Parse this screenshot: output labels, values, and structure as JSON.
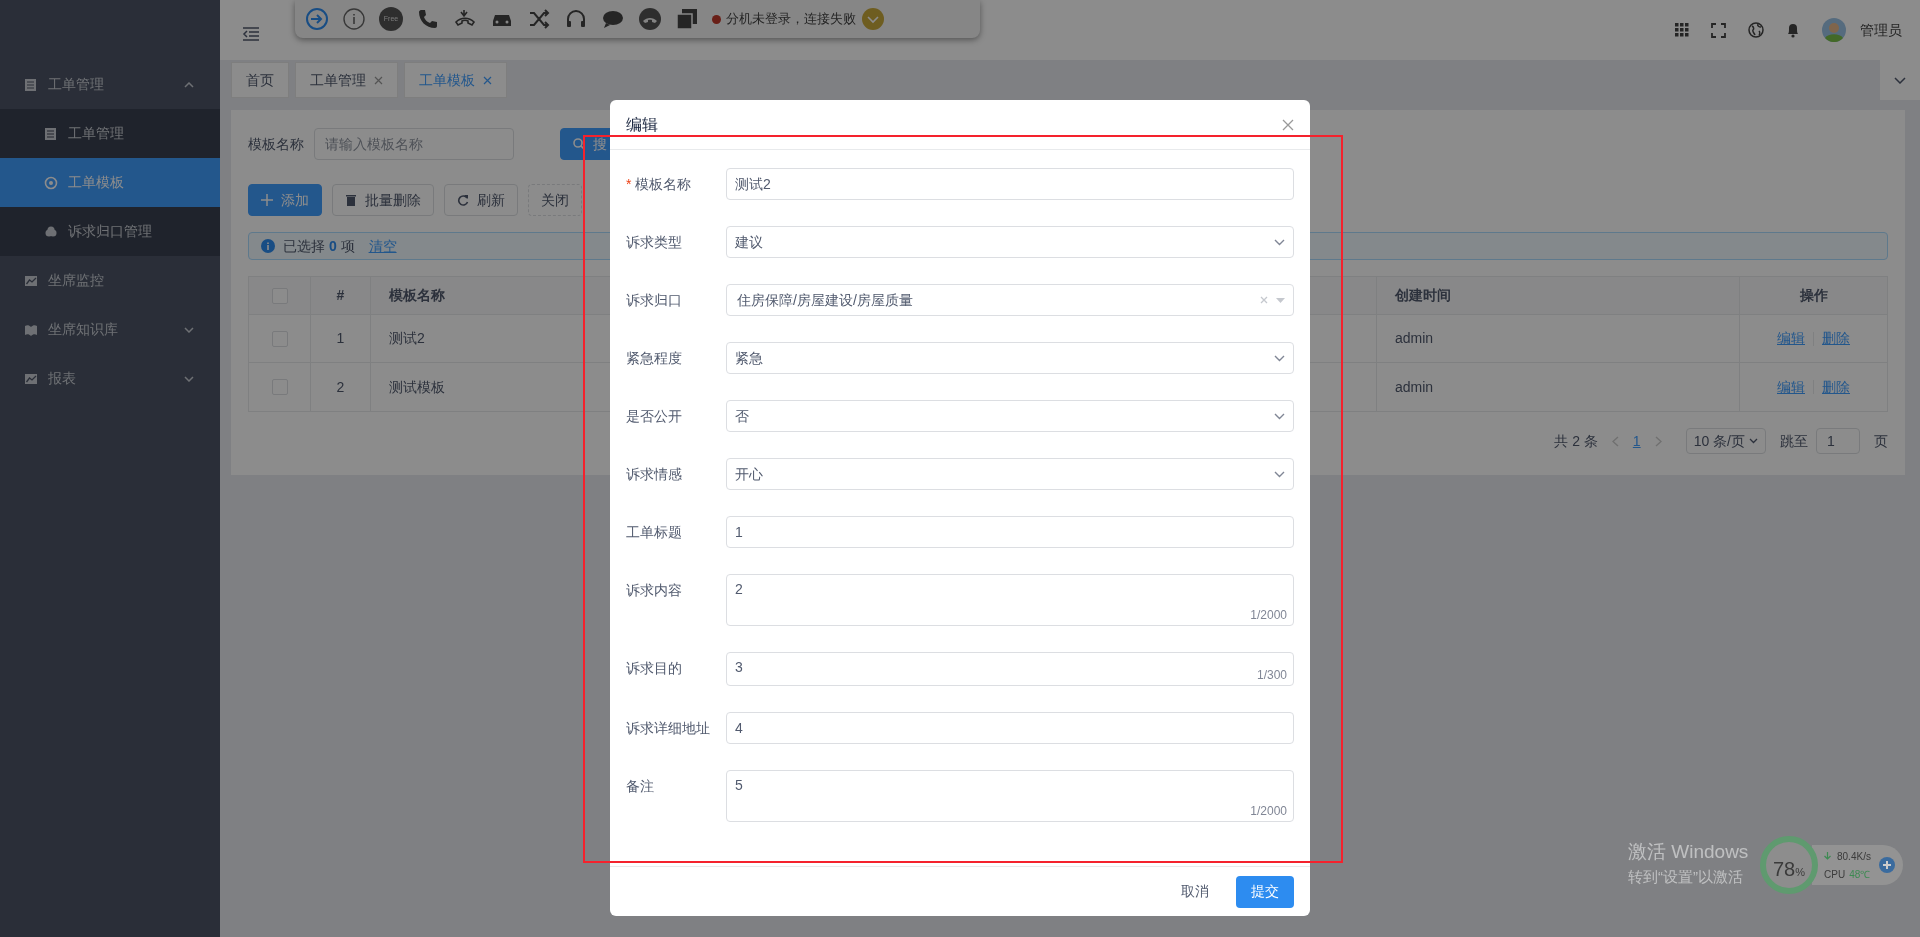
{
  "call_bar": {
    "free_label": "Free",
    "status": "分机未登录，连接失败",
    "connected": false
  },
  "header": {
    "user": "管理员"
  },
  "sidebar": {
    "items": [
      {
        "label": "工单管理",
        "kind": "group",
        "expanded": true,
        "selected": false,
        "children": [
          {
            "label": "工单管理",
            "selected": false
          },
          {
            "label": "工单模板",
            "selected": true
          },
          {
            "label": "诉求归口管理",
            "selected": false
          }
        ]
      },
      {
        "label": "坐席监控",
        "kind": "link",
        "selected": false
      },
      {
        "label": "坐席知识库",
        "kind": "group",
        "expanded": false,
        "selected": false
      },
      {
        "label": "报表",
        "kind": "group",
        "expanded": false,
        "selected": false
      }
    ]
  },
  "tabs": [
    {
      "label": "首页",
      "closable": false,
      "selected": false
    },
    {
      "label": "工单管理",
      "closable": true,
      "selected": false
    },
    {
      "label": "工单模板",
      "closable": true,
      "selected": true
    }
  ],
  "search": {
    "label": "模板名称",
    "placeholder": "请输入模板名称",
    "button": "搜"
  },
  "actions": [
    {
      "label": "添加",
      "kind": "primary"
    },
    {
      "label": "批量删除",
      "kind": "default"
    },
    {
      "label": "刷新",
      "kind": "default"
    },
    {
      "label": "关闭",
      "kind": "dashed"
    }
  ],
  "selection": {
    "prefix": "已选择",
    "count": "0",
    "suffix": "项",
    "clear": "清空"
  },
  "table": {
    "all_checked": false,
    "columns": [
      "#",
      "模板名称",
      "创建时间",
      "操作"
    ],
    "rows": [
      {
        "checked": false,
        "index": "1",
        "name": "测试2",
        "created": "admin",
        "actions": [
          "编辑",
          "删除"
        ]
      },
      {
        "checked": false,
        "index": "2",
        "name": "测试模板",
        "created": "admin",
        "actions": [
          "编辑",
          "删除"
        ]
      }
    ]
  },
  "pagination": {
    "total": "共 2 条",
    "pages": [
      {
        "label": "1",
        "selected": true
      }
    ],
    "page_size": "10 条/页",
    "jump_label": "跳至",
    "jump_value": "1",
    "page_suffix": "页"
  },
  "modal": {
    "title": "编辑",
    "required_mark": "*",
    "fields": [
      {
        "label": "模板名称",
        "required": true,
        "kind": "input",
        "value": "测试2"
      },
      {
        "label": "诉求类型",
        "required": false,
        "kind": "select",
        "value": "建议"
      },
      {
        "label": "诉求归口",
        "required": false,
        "kind": "cascader",
        "value": "住房保障/房屋建设/房屋质量"
      },
      {
        "label": "紧急程度",
        "required": false,
        "kind": "select",
        "value": "紧急"
      },
      {
        "label": "是否公开",
        "required": false,
        "kind": "select",
        "value": "否"
      },
      {
        "label": "诉求情感",
        "required": false,
        "kind": "select",
        "value": "开心"
      },
      {
        "label": "工单标题",
        "required": false,
        "kind": "input",
        "value": "1"
      },
      {
        "label": "诉求内容",
        "required": false,
        "kind": "textarea",
        "value": "2",
        "counter": "1/2000"
      },
      {
        "label": "诉求目的",
        "required": false,
        "kind": "short-textarea",
        "value": "3",
        "counter": "1/300"
      },
      {
        "label": "诉求详细地址",
        "required": false,
        "kind": "input",
        "value": "4"
      },
      {
        "label": "备注",
        "required": false,
        "kind": "textarea",
        "value": "5",
        "counter": "1/2000"
      }
    ],
    "buttons": [
      {
        "label": "取消",
        "kind": "default"
      },
      {
        "label": "提交",
        "kind": "primary"
      }
    ]
  },
  "os_notice": {
    "title": "激活 Windows",
    "subtitle": "转到“设置”以激活"
  },
  "monitor": {
    "percent": "78",
    "unit": "%",
    "speed": "80.4K/s",
    "cpu_label": "CPU",
    "cpu_temp": "48℃"
  }
}
